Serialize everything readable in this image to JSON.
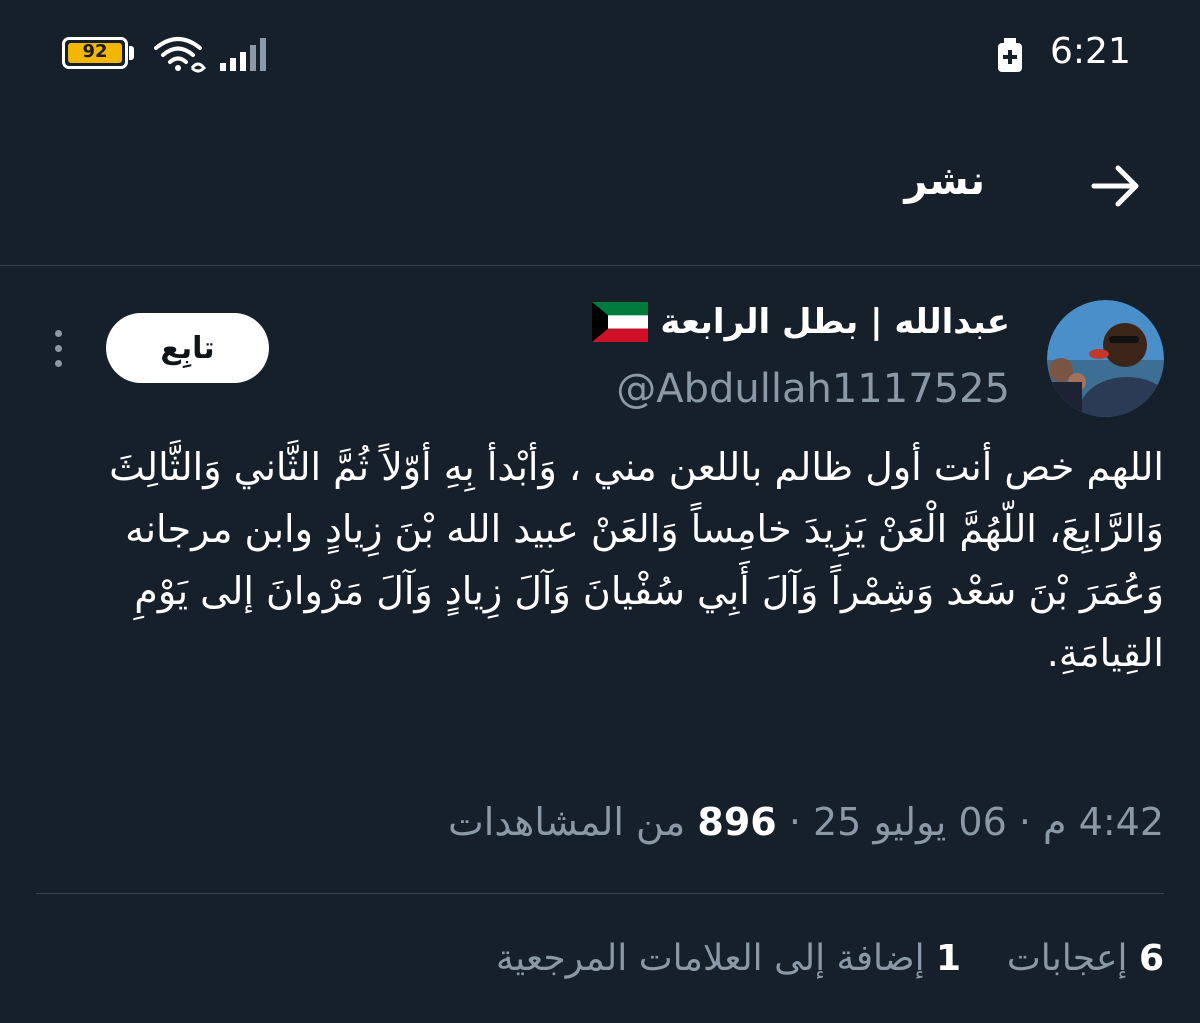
{
  "status_bar": {
    "battery_level": "92",
    "time": "6:21"
  },
  "header": {
    "title": "نشر"
  },
  "tweet": {
    "display_name": "عبدالله | بطل الرابعة",
    "handle": "@Abdullah1117525",
    "follow_label": "تابِع",
    "text": "اللهم خص أنت أول ظالم باللعن مني ، وَأبْدأ بِهِ أوّلاً ثُمَّ الثَّاني وَالثَّالِثَ وَالرَّابِعَ، اللّهُمَّ الْعَنْ يَزِيدَ خامِساً وَالعَنْ عبيد الله بْنَ زِيادٍ وابن مرجانه وَعُمَرَ بْنَ سَعْد وَشِمْراً وَآلَ أَبِي سُفْيانَ وَآلَ زِيادٍ وَآلَ مَرْوانَ إلى يَوْمِ القِيامَةِ.",
    "time": "4:42 م",
    "date": "06 يوليو 25",
    "views_count": "896",
    "views_label": "من المشاهدات",
    "separator": "·",
    "likes_count": "6",
    "likes_label": "إعجابات",
    "bookmarks_count": "1",
    "bookmarks_label": "إضافة إلى العلامات المرجعية"
  },
  "colors": {
    "background": "#15202b",
    "secondary_text": "#8b98a5",
    "divider": "#38444d",
    "battery": "#f2b705"
  },
  "icons": [
    "wifi-icon",
    "signal-icon",
    "battery-icon",
    "charging-icon",
    "back-arrow-icon",
    "more-options-icon",
    "kuwait-flag-emoji"
  ]
}
